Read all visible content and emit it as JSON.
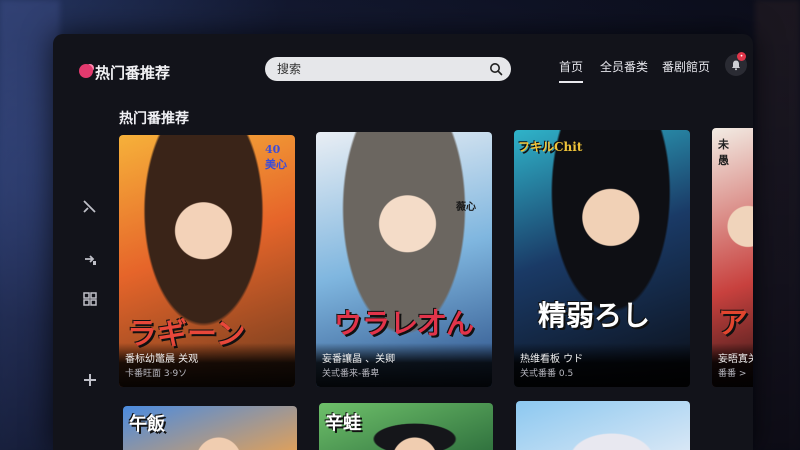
{
  "app": {
    "name": "热门番推荐"
  },
  "search": {
    "placeholder": "搜索"
  },
  "nav": [
    {
      "label": "首页",
      "active": true
    },
    {
      "label": "全员番类",
      "active": false
    },
    {
      "label": "番剧館页",
      "active": false
    }
  ],
  "notifications": {
    "badge": "•"
  },
  "section": {
    "title": "热门番推荐"
  },
  "sidebar_icons": [
    "sword-icon",
    "arrow-icon",
    "grid-icon",
    "add-icon"
  ],
  "cards": [
    {
      "poster_caption": "ラギーン",
      "poster_tag": "40 美心",
      "title": "番标幼鼈晨 关观",
      "subtitle": "卡番旺面 3·9ソ"
    },
    {
      "poster_caption": "ウラレ才ん",
      "poster_tag": "薇心",
      "title": "妄番讓晶 、关卿",
      "subtitle": "关弎番来-番卑"
    },
    {
      "poster_caption": "精弱ろし",
      "poster_tag": "フキルChit",
      "title": "热维看板 ウド",
      "subtitle": "关弎番番 0.5"
    },
    {
      "poster_caption": "ア",
      "poster_tag": "未愚",
      "title": "妄晤寘关",
      "subtitle": "番番 >"
    },
    {
      "poster_caption": "",
      "poster_tag": "午飯",
      "title": "",
      "subtitle": ""
    },
    {
      "poster_caption": "",
      "poster_tag": "辛蛙",
      "title": "",
      "subtitle": ""
    },
    {
      "poster_caption": "",
      "poster_tag": "",
      "title": "",
      "subtitle": ""
    }
  ],
  "colors": {
    "accent": "#e23a6e",
    "window_bg": "#12131a",
    "search_bg": "#e6e7ea"
  }
}
